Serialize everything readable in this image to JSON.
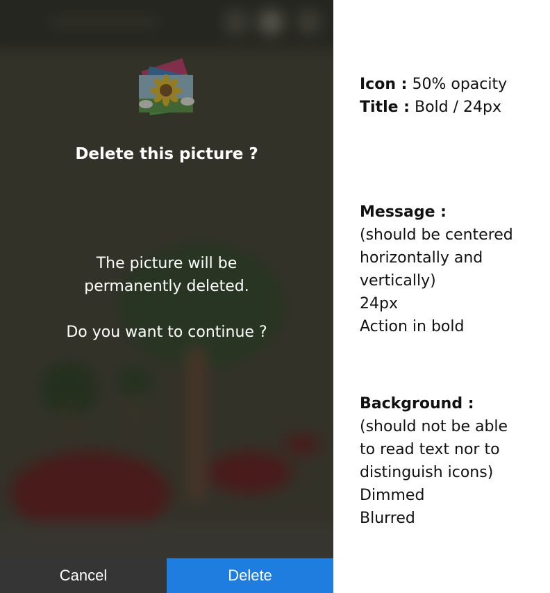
{
  "dialog": {
    "title": "Delete this picture ?",
    "message_line_1": "The picture will be",
    "message_line_2": "permanently deleted.",
    "message_line_3": "Do you want to continue ?",
    "cancel_label": "Cancel",
    "delete_label": "Delete",
    "icon": "image-stack-icon",
    "colors": {
      "delete_button": "#1e7ddf",
      "cancel_button": "#353535",
      "background": "#3c3b31"
    }
  },
  "annotations": {
    "icon": {
      "label": "Icon :",
      "text": "50% opacity"
    },
    "title": {
      "label": "Title :",
      "text": "Bold / 24px"
    },
    "message": {
      "label": "Message :",
      "lines": [
        "(should be centered",
        "horizontally and",
        "vertically)",
        "24px",
        "Action in bold"
      ]
    },
    "background": {
      "label": "Background :",
      "lines": [
        "(should not be able",
        "to read text nor to",
        "distinguish icons)",
        "Dimmed",
        "Blurred"
      ]
    }
  }
}
